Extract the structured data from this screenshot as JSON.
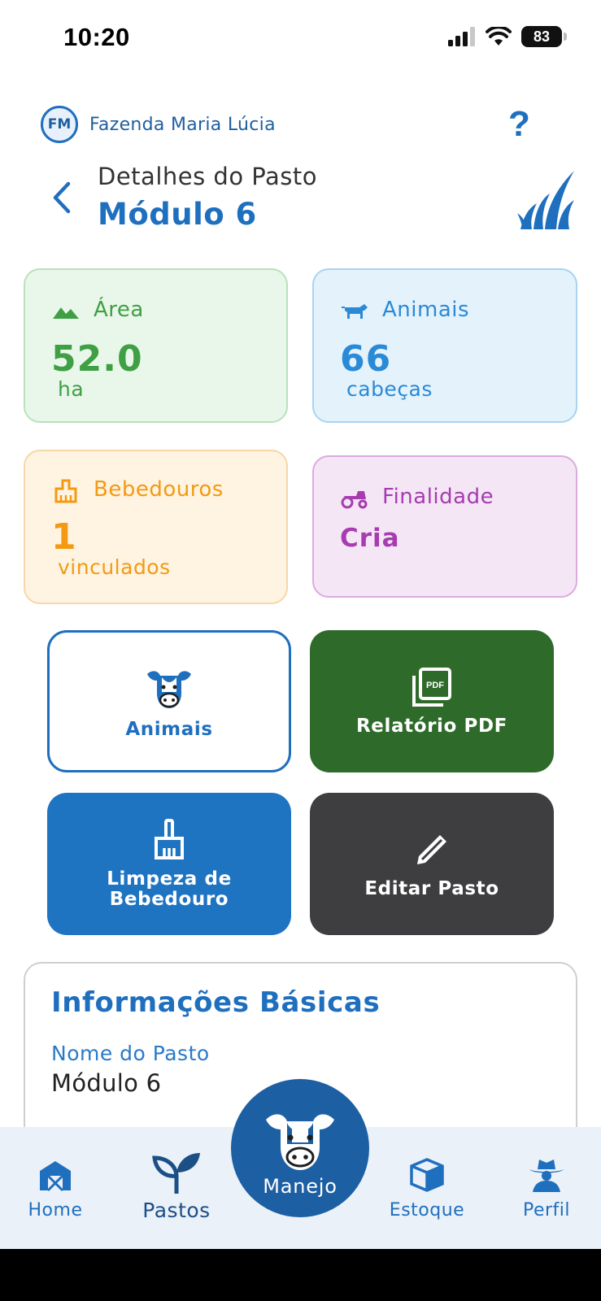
{
  "status_bar": {
    "time": "10:20",
    "battery": "83"
  },
  "header": {
    "farm_initials": "FM",
    "farm_name": "Fazenda Maria Lúcia",
    "help": "?",
    "subtitle": "Detalhes do Pasto",
    "title": "Módulo 6"
  },
  "stats": {
    "area": {
      "label": "Área",
      "value": "52.0",
      "unit": "ha",
      "color": "#3f9f44"
    },
    "animais": {
      "label": "Animais",
      "value": "66",
      "unit": "cabeças",
      "color": "#2a8ad6"
    },
    "bebedouros": {
      "label": "Bebedouros",
      "value": "1",
      "unit": "vinculados",
      "color": "#f39a12"
    },
    "finalidade": {
      "label": "Finalidade",
      "value": "Cria",
      "color": "#a63cb0"
    }
  },
  "actions": {
    "animais": "Animais",
    "relatorio_pdf": "Relatório PDF",
    "limpeza_line1": "Limpeza de",
    "limpeza_line2": "Bebedouro",
    "editar": "Editar Pasto"
  },
  "info": {
    "title": "Informações Básicas",
    "nome_label": "Nome do Pasto",
    "nome_value": "Módulo 6"
  },
  "nav": {
    "home": "Home",
    "pastos": "Pastos",
    "manejo": "Manejo",
    "estoque": "Estoque",
    "perfil": "Perfil"
  },
  "colors": {
    "primary": "#1f6fbf",
    "pdf_button": "#2e6b2a",
    "limpeza_button": "#1f74c2",
    "editar_button": "#3e3e40",
    "nav_background": "#eaf1f8",
    "fab": "#1d5fa3"
  }
}
